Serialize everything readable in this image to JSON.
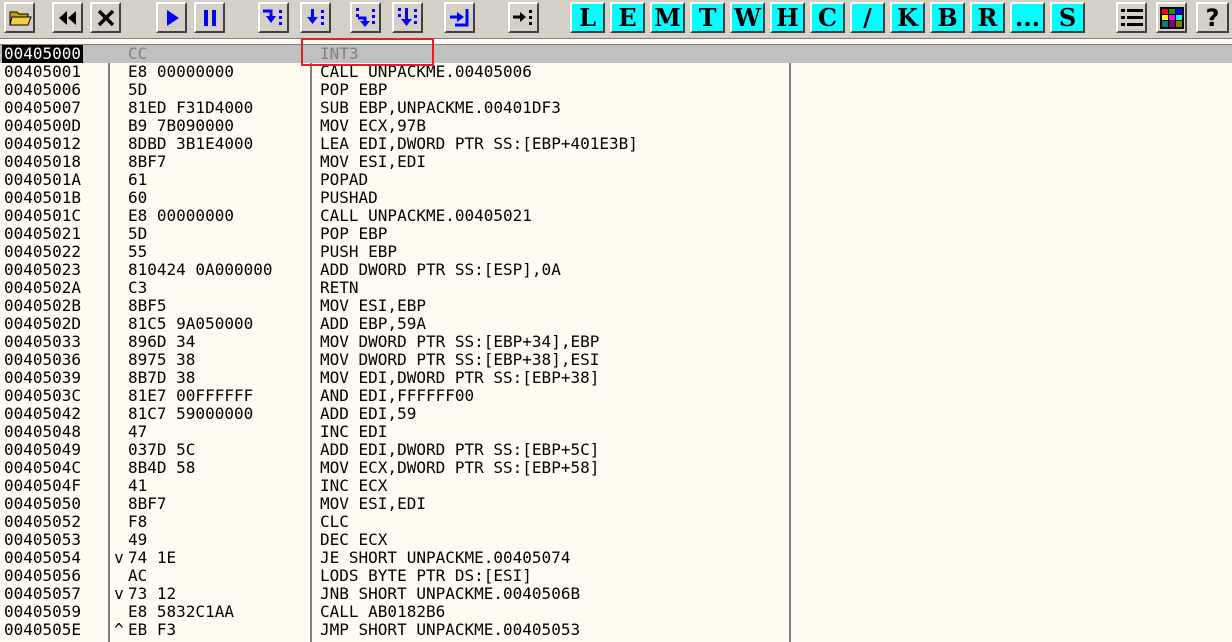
{
  "toolbar": {
    "icons": [
      {
        "name": "open-icon",
        "color": "#c8a000"
      },
      {
        "name": "restart-icon",
        "color": "#000000"
      },
      {
        "name": "close-icon",
        "color": "#000000"
      },
      {
        "name": "run-icon",
        "color": "#0000ff"
      },
      {
        "name": "pause-icon",
        "color": "#0000ff"
      },
      {
        "name": "step-into-icon",
        "color": "#0000ff"
      },
      {
        "name": "step-over-icon",
        "color": "#0000ff"
      },
      {
        "name": "trace-into-icon",
        "color": "#0000ff"
      },
      {
        "name": "trace-over-icon",
        "color": "#0000ff"
      },
      {
        "name": "execute-till-return-icon",
        "color": "#0000ff"
      },
      {
        "name": "go-to-icon",
        "color": "#000000"
      }
    ],
    "letters": [
      "L",
      "E",
      "M",
      "T",
      "W",
      "H",
      "C",
      "/",
      "K",
      "B",
      "R",
      "...",
      "S"
    ],
    "right_icons": [
      {
        "name": "list-icon"
      },
      {
        "name": "palette-icon"
      },
      {
        "name": "help-icon",
        "glyph": "?"
      }
    ],
    "letter_color": "#00ffff"
  },
  "disassembly": {
    "rows": [
      {
        "address": "00405000",
        "jump": "",
        "hex": "CC",
        "asm": "INT3",
        "selected": true
      },
      {
        "address": "00405001",
        "jump": "",
        "hex": "E8 00000000",
        "asm": "CALL UNPACKME.00405006"
      },
      {
        "address": "00405006",
        "jump": "",
        "hex": "5D",
        "asm": "POP EBP"
      },
      {
        "address": "00405007",
        "jump": "",
        "hex": "81ED F31D4000",
        "asm": "SUB EBP,UNPACKME.00401DF3"
      },
      {
        "address": "0040500D",
        "jump": "",
        "hex": "B9 7B090000",
        "asm": "MOV ECX,97B"
      },
      {
        "address": "00405012",
        "jump": "",
        "hex": "8DBD 3B1E4000",
        "asm": "LEA EDI,DWORD PTR SS:[EBP+401E3B]"
      },
      {
        "address": "00405018",
        "jump": "",
        "hex": "8BF7",
        "asm": "MOV ESI,EDI"
      },
      {
        "address": "0040501A",
        "jump": "",
        "hex": "61",
        "asm": "POPAD"
      },
      {
        "address": "0040501B",
        "jump": "",
        "hex": "60",
        "asm": "PUSHAD"
      },
      {
        "address": "0040501C",
        "jump": "",
        "hex": "E8 00000000",
        "asm": "CALL UNPACKME.00405021"
      },
      {
        "address": "00405021",
        "jump": "",
        "hex": "5D",
        "asm": "POP EBP"
      },
      {
        "address": "00405022",
        "jump": "",
        "hex": "55",
        "asm": "PUSH EBP"
      },
      {
        "address": "00405023",
        "jump": "",
        "hex": "810424 0A000000",
        "asm": "ADD DWORD PTR SS:[ESP],0A"
      },
      {
        "address": "0040502A",
        "jump": "",
        "hex": "C3",
        "asm": "RETN"
      },
      {
        "address": "0040502B",
        "jump": "",
        "hex": "8BF5",
        "asm": "MOV ESI,EBP"
      },
      {
        "address": "0040502D",
        "jump": "",
        "hex": "81C5 9A050000",
        "asm": "ADD EBP,59A"
      },
      {
        "address": "00405033",
        "jump": "",
        "hex": "896D 34",
        "asm": "MOV DWORD PTR SS:[EBP+34],EBP"
      },
      {
        "address": "00405036",
        "jump": "",
        "hex": "8975 38",
        "asm": "MOV DWORD PTR SS:[EBP+38],ESI"
      },
      {
        "address": "00405039",
        "jump": "",
        "hex": "8B7D 38",
        "asm": "MOV EDI,DWORD PTR SS:[EBP+38]"
      },
      {
        "address": "0040503C",
        "jump": "",
        "hex": "81E7 00FFFFFF",
        "asm": "AND EDI,FFFFFF00"
      },
      {
        "address": "00405042",
        "jump": "",
        "hex": "81C7 59000000",
        "asm": "ADD EDI,59"
      },
      {
        "address": "00405048",
        "jump": "",
        "hex": "47",
        "asm": "INC EDI"
      },
      {
        "address": "00405049",
        "jump": "",
        "hex": "037D 5C",
        "asm": "ADD EDI,DWORD PTR SS:[EBP+5C]"
      },
      {
        "address": "0040504C",
        "jump": "",
        "hex": "8B4D 58",
        "asm": "MOV ECX,DWORD PTR SS:[EBP+58]"
      },
      {
        "address": "0040504F",
        "jump": "",
        "hex": "41",
        "asm": "INC ECX"
      },
      {
        "address": "00405050",
        "jump": "",
        "hex": "8BF7",
        "asm": "MOV ESI,EDI"
      },
      {
        "address": "00405052",
        "jump": "",
        "hex": "F8",
        "asm": "CLC"
      },
      {
        "address": "00405053",
        "jump": "",
        "hex": "49",
        "asm": "DEC ECX"
      },
      {
        "address": "00405054",
        "jump": "v",
        "hex": "74 1E",
        "asm": "JE SHORT UNPACKME.00405074"
      },
      {
        "address": "00405056",
        "jump": "",
        "hex": "AC",
        "asm": "LODS BYTE PTR DS:[ESI]"
      },
      {
        "address": "00405057",
        "jump": "v",
        "hex": "73 12",
        "asm": "JNB SHORT UNPACKME.0040506B"
      },
      {
        "address": "00405059",
        "jump": "",
        "hex": "E8 5832C1AA",
        "asm": "CALL AB0182B6"
      },
      {
        "address": "0040505E",
        "jump": "^",
        "hex": "EB F3",
        "asm": "JMP SHORT UNPACKME.00405053"
      }
    ],
    "highlight_color": "#e0202a"
  }
}
